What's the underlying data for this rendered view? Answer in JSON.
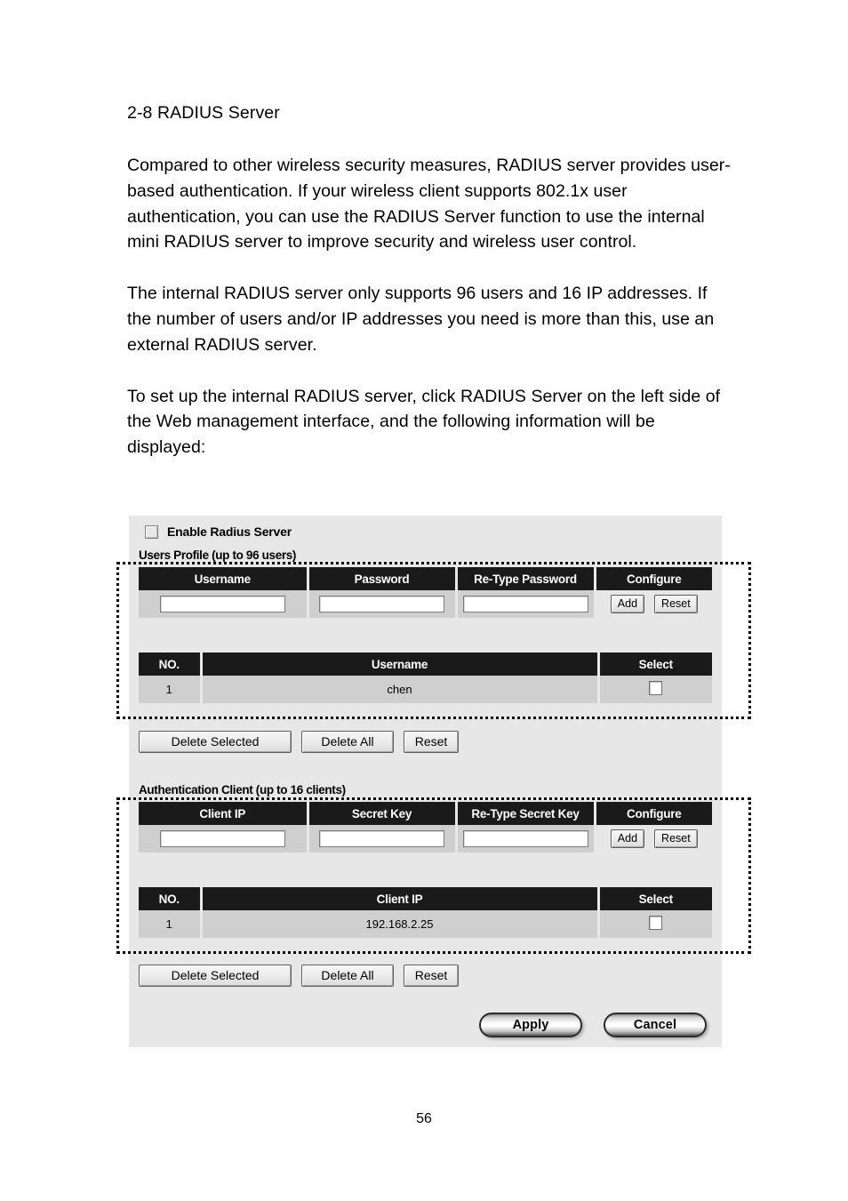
{
  "document": {
    "heading": "2-8 RADIUS Server",
    "paragraphs": [
      "Compared to other wireless security measures, RADIUS server provides user-based authentication. If your wireless client supports 802.1x user authentication, you can use the RADIUS Server function to use the internal mini RADIUS server to improve security and wireless user control.",
      "The internal RADIUS server only supports 96 users and 16 IP addresses. If the number of users and/or IP addresses you need is more than this, use an external RADIUS server.",
      "To set up the internal RADIUS server, click RADIUS Server on the left side of the Web management interface, and the following information will be displayed:"
    ],
    "page_number": "56"
  },
  "panel": {
    "enable_checkbox_label": "Enable Radius Server",
    "enable_checkbox_checked": false,
    "users_section": {
      "title": "Users Profile (up to 96 users)",
      "entry_headers": [
        "Username",
        "Password",
        "Re-Type Password",
        "Configure"
      ],
      "entry_values": {
        "username": "",
        "password": "",
        "retype_password": ""
      },
      "entry_buttons": {
        "add": "Add",
        "reset": "Reset"
      },
      "list_headers": [
        "NO.",
        "Username",
        "Select"
      ],
      "list_rows": [
        {
          "no": "1",
          "value": "chen",
          "selected": false
        }
      ],
      "actions": [
        "Delete Selected",
        "Delete All",
        "Reset"
      ]
    },
    "clients_section": {
      "title": "Authentication Client (up to 16 clients)",
      "entry_headers": [
        "Client IP",
        "Secret Key",
        "Re-Type Secret Key",
        "Configure"
      ],
      "entry_values": {
        "client_ip": "",
        "secret_key": "",
        "retype_secret_key": ""
      },
      "entry_buttons": {
        "add": "Add",
        "reset": "Reset"
      },
      "list_headers": [
        "NO.",
        "Client IP",
        "Select"
      ],
      "list_rows": [
        {
          "no": "1",
          "value": "192.168.2.25",
          "selected": false
        }
      ],
      "actions": [
        "Delete Selected",
        "Delete All",
        "Reset"
      ]
    },
    "footer_buttons": {
      "apply": "Apply",
      "cancel": "Cancel"
    },
    "colors": {
      "panel_background": "#e7e7e7",
      "table_header_background": "#1a1a1a",
      "table_header_text": "#ffffff",
      "row_background": "#cfcfcf",
      "annotation_outline": "#000000"
    }
  }
}
